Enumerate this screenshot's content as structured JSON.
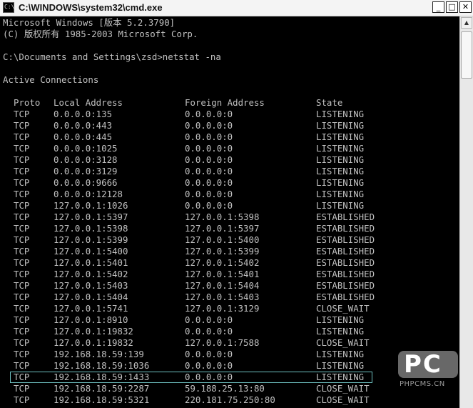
{
  "window": {
    "title": "C:\\WINDOWS\\system32\\cmd.exe",
    "icon_label": "C:\\",
    "minimize_glyph": "_",
    "maximize_glyph": "□",
    "close_glyph": "✕"
  },
  "console": {
    "header_lines": [
      "Microsoft Windows [版本 5.2.3790]",
      "(C) 版权所有 1985-2003 Microsoft Corp.",
      "",
      "C:\\Documents and Settings\\zsd>netstat -na",
      "",
      "Active Connections",
      ""
    ],
    "columns": {
      "proto": "Proto",
      "local": "Local Address",
      "foreign": "Foreign Address",
      "state": "State"
    },
    "rows": [
      [
        "TCP",
        "0.0.0.0:135",
        "0.0.0.0:0",
        "LISTENING"
      ],
      [
        "TCP",
        "0.0.0.0:443",
        "0.0.0.0:0",
        "LISTENING"
      ],
      [
        "TCP",
        "0.0.0.0:445",
        "0.0.0.0:0",
        "LISTENING"
      ],
      [
        "TCP",
        "0.0.0.0:1025",
        "0.0.0.0:0",
        "LISTENING"
      ],
      [
        "TCP",
        "0.0.0.0:3128",
        "0.0.0.0:0",
        "LISTENING"
      ],
      [
        "TCP",
        "0.0.0.0:3129",
        "0.0.0.0:0",
        "LISTENING"
      ],
      [
        "TCP",
        "0.0.0.0:9666",
        "0.0.0.0:0",
        "LISTENING"
      ],
      [
        "TCP",
        "0.0.0.0:12128",
        "0.0.0.0:0",
        "LISTENING"
      ],
      [
        "TCP",
        "127.0.0.1:1026",
        "0.0.0.0:0",
        "LISTENING"
      ],
      [
        "TCP",
        "127.0.0.1:5397",
        "127.0.0.1:5398",
        "ESTABLISHED"
      ],
      [
        "TCP",
        "127.0.0.1:5398",
        "127.0.0.1:5397",
        "ESTABLISHED"
      ],
      [
        "TCP",
        "127.0.0.1:5399",
        "127.0.0.1:5400",
        "ESTABLISHED"
      ],
      [
        "TCP",
        "127.0.0.1:5400",
        "127.0.0.1:5399",
        "ESTABLISHED"
      ],
      [
        "TCP",
        "127.0.0.1:5401",
        "127.0.0.1:5402",
        "ESTABLISHED"
      ],
      [
        "TCP",
        "127.0.0.1:5402",
        "127.0.0.1:5401",
        "ESTABLISHED"
      ],
      [
        "TCP",
        "127.0.0.1:5403",
        "127.0.0.1:5404",
        "ESTABLISHED"
      ],
      [
        "TCP",
        "127.0.0.1:5404",
        "127.0.0.1:5403",
        "ESTABLISHED"
      ],
      [
        "TCP",
        "127.0.0.1:5741",
        "127.0.0.1:3129",
        "CLOSE_WAIT"
      ],
      [
        "TCP",
        "127.0.0.1:8910",
        "0.0.0.0:0",
        "LISTENING"
      ],
      [
        "TCP",
        "127.0.0.1:19832",
        "0.0.0.0:0",
        "LISTENING"
      ],
      [
        "TCP",
        "127.0.0.1:19832",
        "127.0.0.1:7588",
        "CLOSE_WAIT"
      ],
      [
        "TCP",
        "192.168.18.59:139",
        "0.0.0.0:0",
        "LISTENING"
      ],
      [
        "TCP",
        "192.168.18.59:1036",
        "0.0.0.0:0",
        "LISTENING"
      ],
      [
        "TCP",
        "192.168.18.59:1433",
        "0.0.0.0:0",
        "LISTENING"
      ],
      [
        "TCP",
        "192.168.18.59:2287",
        "59.188.25.13:80",
        "CLOSE_WAIT"
      ],
      [
        "TCP",
        "192.168.18.59:5321",
        "220.181.75.250:80",
        "CLOSE_WAIT"
      ]
    ],
    "highlighted_row": 23
  },
  "scrollbar": {
    "up_glyph": "▲",
    "position": 0.04
  },
  "watermark": {
    "letters": "PC",
    "url": "PHPCMS.CN"
  },
  "colors": {
    "console_bg": "#000000",
    "console_fg": "#c0c0c0",
    "highlight_outline": "#6ec0c0"
  }
}
